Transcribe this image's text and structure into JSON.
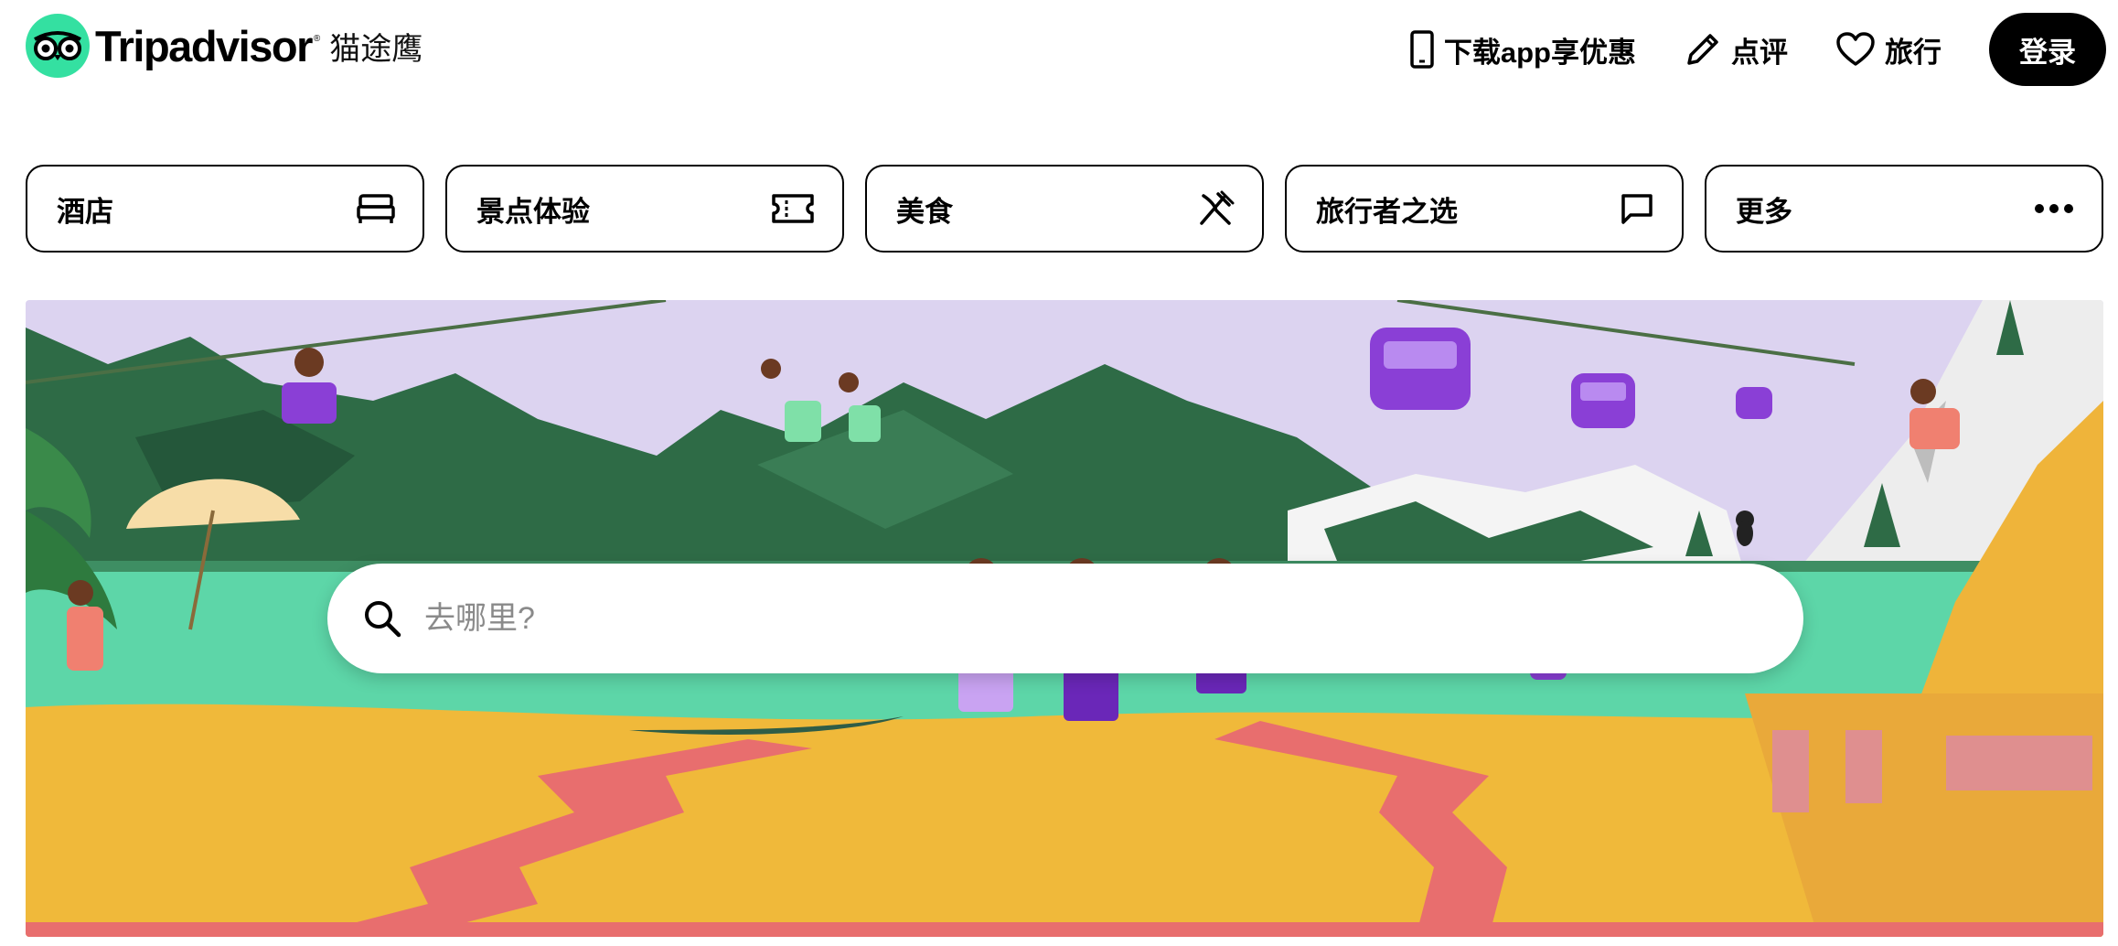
{
  "header": {
    "brand": "Tripadvisor",
    "brand_reg": "®",
    "brand_cn": "猫途鹰",
    "nav": [
      {
        "label": "下载app享优惠",
        "icon": "phone-icon"
      },
      {
        "label": "点评",
        "icon": "pencil-icon"
      },
      {
        "label": "旅行",
        "icon": "heart-icon"
      }
    ],
    "login_label": "登录"
  },
  "categories": [
    {
      "label": "酒店",
      "icon": "bed-icon"
    },
    {
      "label": "景点体验",
      "icon": "ticket-icon"
    },
    {
      "label": "美食",
      "icon": "cutlery-icon"
    },
    {
      "label": "旅行者之选",
      "icon": "chat-icon"
    },
    {
      "label": "更多",
      "icon": "more-icon"
    }
  ],
  "search": {
    "placeholder": "去哪里?"
  },
  "colors": {
    "brand_green": "#34E0A1",
    "text": "#000000",
    "sky": "#DCD3F0",
    "mountain": "#2E6B46",
    "sea": "#5DD6A8",
    "sand": "#F0B93A",
    "boardwalk": "#E86E6E",
    "purple": "#8A3FD6"
  }
}
